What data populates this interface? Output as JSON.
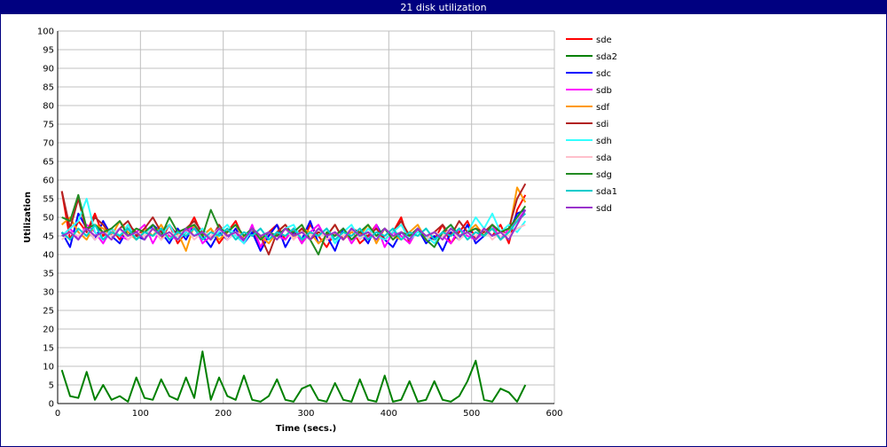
{
  "window": {
    "title": "21 disk utilization"
  },
  "colors": {
    "titlebar": "#000080",
    "grid": "#c0c0c0",
    "axis": "#000000"
  },
  "chart_data": {
    "type": "line",
    "title": "21 disk utilization",
    "xlabel": "Time (secs.)",
    "ylabel": "Utilization",
    "xlim": [
      0,
      600
    ],
    "ylim": [
      0,
      100
    ],
    "xticks": [
      0,
      100,
      200,
      300,
      400,
      500,
      600
    ],
    "yticks": [
      0,
      5,
      10,
      15,
      20,
      25,
      30,
      35,
      40,
      45,
      50,
      55,
      60,
      65,
      70,
      75,
      80,
      85,
      90,
      95,
      100
    ],
    "grid": true,
    "legend_position": "right",
    "x": [
      5,
      15,
      25,
      35,
      45,
      55,
      65,
      75,
      85,
      95,
      105,
      115,
      125,
      135,
      145,
      155,
      165,
      175,
      185,
      195,
      205,
      215,
      225,
      235,
      245,
      255,
      265,
      275,
      285,
      295,
      305,
      315,
      325,
      335,
      345,
      355,
      365,
      375,
      385,
      395,
      405,
      415,
      425,
      435,
      445,
      455,
      465,
      475,
      485,
      495,
      505,
      515,
      525,
      535,
      545,
      555,
      565
    ],
    "series": [
      {
        "name": "sde",
        "color": "#ff0000",
        "values": [
          57,
          44,
          49,
          46,
          51,
          45,
          47,
          44,
          48,
          46,
          45,
          47,
          44,
          48,
          43,
          46,
          50,
          45,
          47,
          43,
          46,
          49,
          44,
          47,
          42,
          46,
          48,
          44,
          47,
          43,
          48,
          45,
          42,
          46,
          44,
          47,
          43,
          45,
          48,
          44,
          46,
          50,
          43,
          47,
          45,
          44,
          48,
          43,
          46,
          49,
          44,
          47,
          45,
          48,
          43,
          52,
          56
        ]
      },
      {
        "name": "sda2",
        "color": "#008000",
        "values": [
          9,
          2,
          1.5,
          8.5,
          1,
          5,
          1,
          2,
          0.5,
          7,
          1.5,
          1,
          6.5,
          2,
          1,
          7,
          1.5,
          14,
          1,
          7,
          2,
          1,
          7.5,
          1,
          0.5,
          2,
          6.5,
          1,
          0.5,
          4,
          5,
          1,
          0.5,
          5.5,
          1,
          0.5,
          6.5,
          1,
          0.5,
          7.5,
          0.5,
          1,
          6,
          0.5,
          1,
          6,
          1,
          0.5,
          2,
          6,
          11.5,
          1,
          0.5,
          4,
          3,
          0.5,
          5
        ]
      },
      {
        "name": "sdc",
        "color": "#0000ff",
        "values": [
          46,
          42,
          51,
          47,
          44,
          49,
          45,
          43,
          47,
          45,
          44,
          48,
          46,
          43,
          47,
          44,
          48,
          45,
          42,
          46,
          44,
          47,
          43,
          46,
          41,
          45,
          48,
          42,
          46,
          44,
          49,
          43,
          45,
          41,
          47,
          44,
          46,
          43,
          48,
          44,
          42,
          46,
          44,
          47,
          43,
          45,
          41,
          46,
          44,
          48,
          43,
          45,
          47,
          44,
          46,
          51,
          52
        ]
      },
      {
        "name": "sdb",
        "color": "#ff00ff",
        "values": [
          45,
          47,
          44,
          48,
          46,
          43,
          47,
          45,
          44,
          46,
          48,
          43,
          47,
          45,
          44,
          46,
          48,
          43,
          45,
          47,
          44,
          46,
          43,
          48,
          42,
          46,
          45,
          44,
          47,
          43,
          46,
          48,
          44,
          45,
          47,
          43,
          46,
          44,
          48,
          42,
          46,
          45,
          43,
          47,
          44,
          46,
          45,
          43,
          47,
          45,
          44,
          46,
          48,
          44,
          47,
          49,
          52
        ]
      },
      {
        "name": "sdf",
        "color": "#ff9900",
        "values": [
          48,
          50,
          46,
          44,
          48,
          47,
          45,
          49,
          46,
          44,
          47,
          45,
          48,
          44,
          46,
          41,
          48,
          45,
          47,
          44,
          46,
          48,
          44,
          47,
          45,
          43,
          46,
          48,
          44,
          47,
          46,
          43,
          45,
          48,
          44,
          46,
          45,
          48,
          43,
          47,
          45,
          44,
          46,
          48,
          44,
          46,
          45,
          47,
          44,
          46,
          48,
          45,
          47,
          44,
          46,
          58,
          54
        ]
      },
      {
        "name": "sdi",
        "color": "#b22222",
        "values": [
          57,
          47,
          55,
          46,
          50,
          48,
          45,
          47,
          49,
          45,
          47,
          50,
          46,
          48,
          45,
          47,
          49,
          46,
          44,
          48,
          45,
          46,
          44,
          47,
          45,
          40,
          46,
          48,
          45,
          47,
          44,
          46,
          45,
          48,
          44,
          47,
          46,
          45,
          47,
          44,
          46,
          49,
          45,
          47,
          44,
          46,
          48,
          45,
          49,
          46,
          47,
          46,
          48,
          46,
          47,
          55,
          59
        ]
      },
      {
        "name": "sdh",
        "color": "#33ffff",
        "values": [
          45,
          47,
          49,
          55,
          46,
          44,
          47,
          45,
          48,
          44,
          46,
          47,
          45,
          48,
          44,
          46,
          45,
          47,
          44,
          46,
          48,
          45,
          43,
          47,
          44,
          46,
          45,
          47,
          48,
          44,
          46,
          45,
          47,
          43,
          46,
          48,
          44,
          47,
          45,
          44,
          46,
          48,
          44,
          46,
          45,
          43,
          46,
          48,
          44,
          46,
          50,
          47,
          51,
          46,
          48,
          46,
          49
        ]
      },
      {
        "name": "sda",
        "color": "#ffc0cb",
        "values": [
          44,
          46,
          45,
          47,
          44,
          46,
          45,
          47,
          44,
          46,
          45,
          47,
          44,
          46,
          45,
          47,
          44,
          46,
          45,
          47,
          44,
          46,
          45,
          47,
          44,
          46,
          45,
          47,
          44,
          46,
          45,
          47,
          44,
          46,
          45,
          47,
          44,
          46,
          45,
          47,
          44,
          46,
          45,
          47,
          44,
          46,
          45,
          47,
          44,
          46,
          45,
          47,
          44,
          46,
          45,
          47,
          48
        ]
      },
      {
        "name": "sdg",
        "color": "#228b22",
        "values": [
          50,
          49,
          56,
          47,
          48,
          46,
          47,
          49,
          45,
          47,
          46,
          48,
          45,
          50,
          46,
          47,
          48,
          45,
          52,
          47,
          46,
          48,
          45,
          47,
          44,
          46,
          45,
          47,
          46,
          48,
          44,
          40,
          46,
          45,
          47,
          44,
          46,
          48,
          45,
          47,
          44,
          46,
          45,
          47,
          44,
          42,
          46,
          48,
          45,
          46,
          47,
          45,
          48,
          46,
          47,
          50,
          53
        ]
      },
      {
        "name": "sda1",
        "color": "#00cccc",
        "values": [
          46,
          44,
          47,
          45,
          48,
          44,
          46,
          45,
          47,
          44,
          46,
          45,
          47,
          44,
          46,
          45,
          47,
          44,
          46,
          45,
          47,
          44,
          46,
          45,
          47,
          44,
          46,
          45,
          47,
          44,
          46,
          45,
          47,
          44,
          46,
          45,
          47,
          44,
          46,
          45,
          47,
          44,
          46,
          45,
          47,
          44,
          46,
          45,
          47,
          44,
          46,
          45,
          47,
          44,
          46,
          49,
          51
        ]
      },
      {
        "name": "sdd",
        "color": "#9933cc",
        "values": [
          45,
          46,
          44,
          47,
          45,
          46,
          44,
          47,
          45,
          46,
          44,
          47,
          45,
          46,
          44,
          47,
          45,
          46,
          44,
          47,
          45,
          46,
          44,
          47,
          45,
          46,
          44,
          47,
          45,
          46,
          44,
          47,
          45,
          46,
          44,
          47,
          45,
          46,
          44,
          47,
          45,
          46,
          44,
          47,
          45,
          46,
          44,
          47,
          45,
          46,
          44,
          47,
          45,
          46,
          44,
          48,
          52
        ]
      }
    ]
  }
}
